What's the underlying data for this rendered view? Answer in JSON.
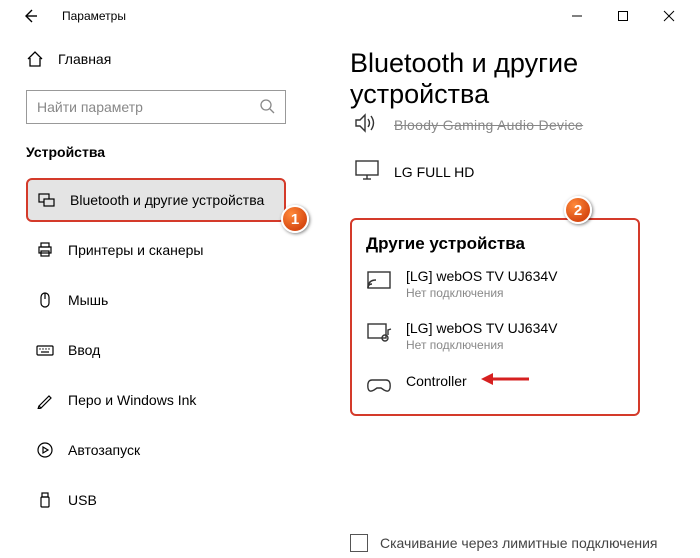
{
  "window": {
    "title": "Параметры"
  },
  "sidebar": {
    "home": "Главная",
    "search_placeholder": "Найти параметр",
    "section": "Устройства",
    "items": [
      {
        "label": "Bluetooth и другие устройства",
        "selected": true
      },
      {
        "label": "Принтеры и сканеры"
      },
      {
        "label": "Мышь"
      },
      {
        "label": "Ввод"
      },
      {
        "label": "Перо и Windows Ink"
      },
      {
        "label": "Автозапуск"
      },
      {
        "label": "USB"
      }
    ]
  },
  "main": {
    "title": "Bluetooth и другие устройства",
    "audio_device": "Bloody Gaming Audio Device",
    "monitor_device": "LG FULL HD",
    "section_title": "Другие устройства",
    "devices": [
      {
        "name": "[LG] webOS TV UJ634V",
        "status": "Нет подключения"
      },
      {
        "name": "[LG] webOS TV UJ634V",
        "status": "Нет подключения"
      },
      {
        "name": "Controller"
      }
    ],
    "download_label": "Скачивание через лимитные подключения"
  },
  "annotations": {
    "badge1": "1",
    "badge2": "2"
  }
}
